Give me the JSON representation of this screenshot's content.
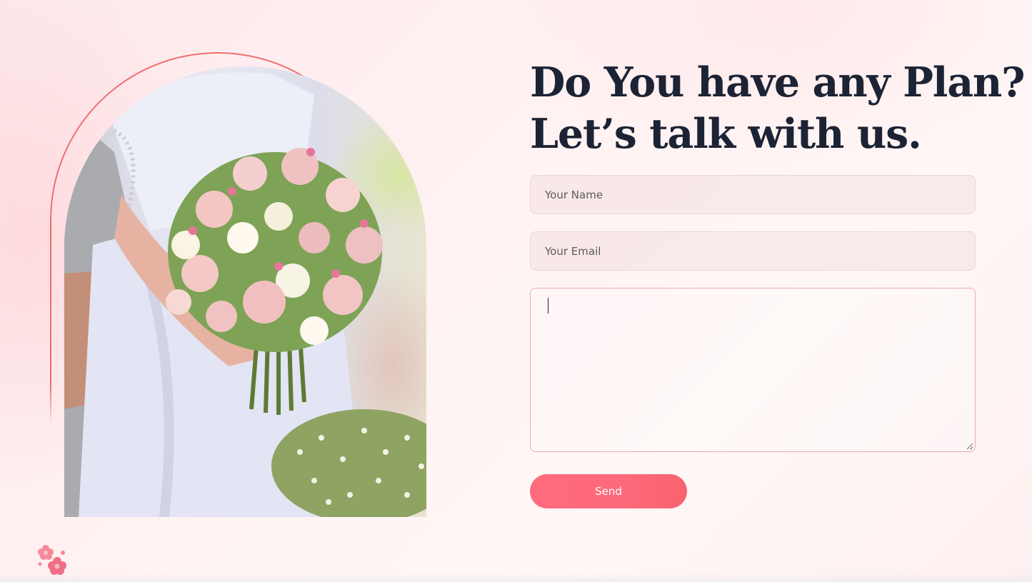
{
  "contact_section": {
    "heading_line1": "Do You have any Plan?",
    "heading_line2": "Let’s talk with us.",
    "name_placeholder": "Your Name",
    "email_placeholder": "Your Email",
    "message_value": "",
    "send_label": "Send"
  },
  "colors": {
    "accent": "#ff6b7c",
    "heading": "#1c2334",
    "arch_outline": "#f06a6e"
  },
  "icons": {
    "decor": "flower-cluster-icon"
  }
}
